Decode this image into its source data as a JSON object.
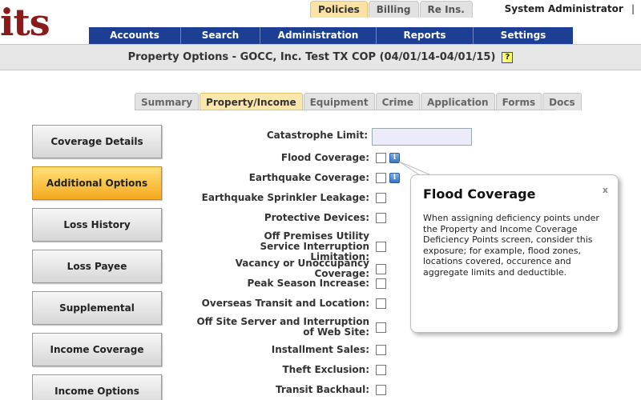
{
  "logo": {
    "text": "its"
  },
  "top_tabs": [
    {
      "label": "Policies",
      "active": true
    },
    {
      "label": "Billing",
      "active": false
    },
    {
      "label": "Re Ins.",
      "active": false
    }
  ],
  "user": {
    "name": "System Administrator",
    "separator": "|"
  },
  "nav": [
    {
      "label": "Accounts"
    },
    {
      "label": "Search"
    },
    {
      "label": "Administration"
    },
    {
      "label": "Reports"
    },
    {
      "label": "Settings"
    }
  ],
  "page": {
    "title": "Property Options - GOCC, Inc. Test TX COP (04/01/14-04/01/15)",
    "help_glyph": "?"
  },
  "sub_tabs": [
    {
      "label": "Summary",
      "active": false
    },
    {
      "label": "Property/Income",
      "active": true
    },
    {
      "label": "Equipment",
      "active": false
    },
    {
      "label": "Crime",
      "active": false
    },
    {
      "label": "Application",
      "active": false
    },
    {
      "label": "Forms",
      "active": false
    },
    {
      "label": "Docs",
      "active": false
    }
  ],
  "sidebar": [
    {
      "label": "Coverage Details",
      "active": false
    },
    {
      "label": "Additional Options",
      "active": true
    },
    {
      "label": "Loss History",
      "active": false
    },
    {
      "label": "Loss Payee",
      "active": false
    },
    {
      "label": "Supplemental",
      "active": false
    },
    {
      "label": "Income Coverage",
      "active": false
    },
    {
      "label": "Income Options",
      "active": false
    }
  ],
  "form": {
    "catastrophe_label": "Catastrophe Limit:",
    "catastrophe_value": "",
    "rows": [
      {
        "label": "Flood Coverage:",
        "checked": false,
        "info": true
      },
      {
        "label": "Earthquake Coverage:",
        "checked": false,
        "info": true
      },
      {
        "label": "Earthquake Sprinkler Leakage:",
        "checked": false
      },
      {
        "label": "Protective Devices:",
        "checked": false
      },
      {
        "label": "Off Premises Utility Service Interruption Limitation:",
        "checked": false
      },
      {
        "label": "Vacancy or Unoccupancy Coverage:",
        "checked": false
      },
      {
        "label": "Peak Season Increase:",
        "checked": false
      },
      {
        "label": "Overseas Transit and Location:",
        "checked": false
      },
      {
        "label": "Off Site Server and Interruption of Web Site:",
        "checked": false
      },
      {
        "label": "Installment Sales:",
        "checked": false
      },
      {
        "label": "Theft Exclusion:",
        "checked": false
      },
      {
        "label": "Transit Backhaul:",
        "checked": false
      }
    ],
    "info_glyph": "i"
  },
  "tooltip": {
    "title": "Flood Coverage",
    "close": "x",
    "body": "When assigning deficiency points under the Property and Income Coverage Deficiency Points screen, consider this exposure; for example, flood zones, locations covered, occurence and aggregate limits and deductible."
  }
}
